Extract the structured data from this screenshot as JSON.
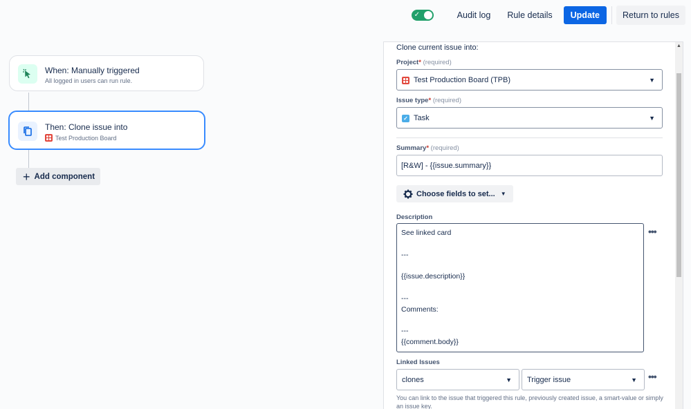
{
  "topbar": {
    "audit_log": "Audit log",
    "rule_details": "Rule details",
    "update": "Update",
    "return_to_rules": "Return to rules",
    "toggle_check": "✓"
  },
  "flow": {
    "trigger": {
      "title": "When: Manually triggered",
      "subtitle": "All logged in users can run rule.",
      "icon": "cursor-click-icon",
      "icon_color": "#1f845a",
      "icon_bg": "#dcfff1"
    },
    "action": {
      "title": "Then: Clone issue into",
      "subtitle": "Test Production Board",
      "icon": "copy-icon",
      "icon_color": "#0c66e4",
      "icon_bg": "#e9f2ff"
    },
    "add_component": "Add component"
  },
  "panel": {
    "heading": "Clone current issue into:",
    "project": {
      "label": "Project",
      "required_mark": "*",
      "required_text": "(required)",
      "value": "Test Production Board (TPB)"
    },
    "issue_type": {
      "label": "Issue type",
      "required_mark": "*",
      "required_text": "(required)",
      "value": "Task"
    },
    "summary": {
      "label": "Summary",
      "required_mark": "*",
      "required_text": "(required)",
      "value": "[R&W] - {{issue.summary}}"
    },
    "choose_fields": "Choose fields to set...",
    "description": {
      "label": "Description",
      "lines": [
        "See linked card",
        "---",
        "{{issue.description}}",
        "---",
        "Comments:",
        "---",
        "{{comment.body}}"
      ]
    },
    "linked_issues": {
      "label": "Linked Issues",
      "relation": "clones",
      "target": "Trigger issue",
      "help": "You can link to the issue that triggered this rule, previously created issue, a smart-value or simply an issue key."
    }
  },
  "colors": {
    "primary": "#0c66e4",
    "toggle_on": "#22a06b",
    "selected_border": "#388bff",
    "required": "#c9372c"
  }
}
